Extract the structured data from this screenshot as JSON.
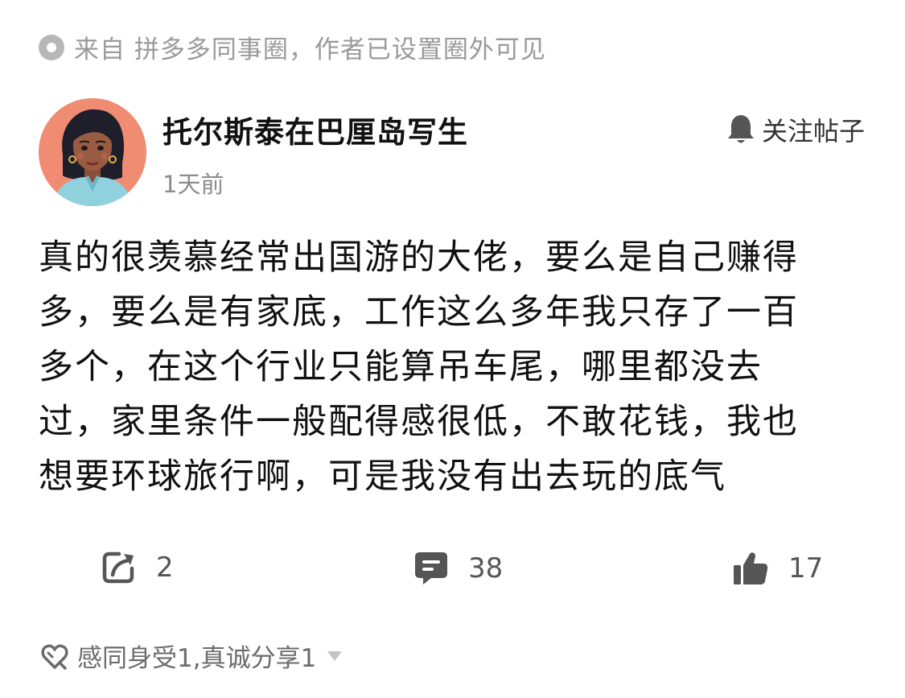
{
  "source": {
    "icon": "circle-dot-icon",
    "text": "来自 拼多多同事圈，作者已设置圈外可见"
  },
  "author": {
    "name": "托尔斯泰在巴厘岛写生",
    "time": "1天前",
    "avatar": "cartoon-woman-avatar"
  },
  "follow": {
    "icon": "bell-icon",
    "label": "关注帖子"
  },
  "post": {
    "lines": [
      "真的很羡慕经常出国游的大佬，要么是自己赚得",
      "多，要么是有家底，工作这么多年我只存了一百",
      "多个，在这个行业只能算吊车尾，哪里都没去",
      "过，家里条件一般配得感很低，不敢花钱，我也",
      "想要环球旅行啊，可是我没有出去玩的底气"
    ]
  },
  "actions": {
    "share": {
      "icon": "share-arrow-icon",
      "count": "2"
    },
    "comment": {
      "icon": "comment-icon",
      "count": "38"
    },
    "like": {
      "icon": "thumbs-up-icon",
      "count": "17"
    }
  },
  "reactions": {
    "icon": "heart-hands-icon",
    "text": "感同身受1,真诚分享1",
    "caret_icon": "caret-down-icon"
  },
  "colors": {
    "muted": "#9a9a9a",
    "text": "#111111",
    "icon": "#555555",
    "avatar_bg": "#f08c72"
  }
}
